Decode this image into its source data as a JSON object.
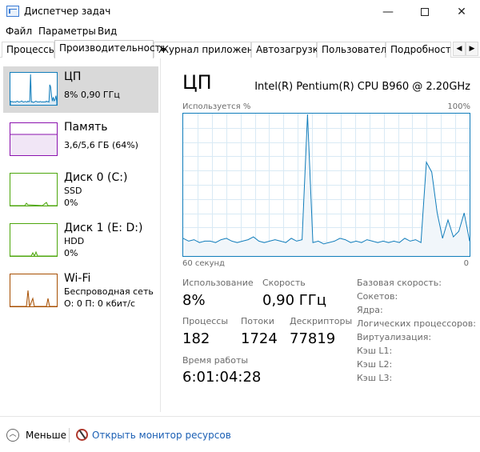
{
  "window": {
    "title": "Диспетчер задач",
    "controls": {
      "minimize": "—",
      "close": "✕"
    }
  },
  "menu": [
    "Файл",
    "Параметры",
    "Вид"
  ],
  "tabs": [
    {
      "label": "Процессы",
      "active": false
    },
    {
      "label": "Производительность",
      "active": true
    },
    {
      "label": "Журнал приложений",
      "active": false
    },
    {
      "label": "Автозагрузка",
      "active": false
    },
    {
      "label": "Пользователи",
      "active": false
    },
    {
      "label": "Подробности",
      "active": false
    }
  ],
  "tab_scroll": {
    "left": "◀",
    "right": "▶"
  },
  "sidebar": [
    {
      "title": "ЦП",
      "lines": [
        "8% 0,90 ГГц"
      ],
      "color": "#117dbb",
      "fill": "#dbeaf4",
      "selected": true
    },
    {
      "title": "Память",
      "lines": [
        "3,6/5,6 ГБ (64%)"
      ],
      "color": "#8b12ae",
      "fill": "#f1e6f6",
      "selected": false
    },
    {
      "title": "Диск 0 (C:)",
      "lines": [
        "SSD",
        "0%"
      ],
      "color": "#4da60c",
      "fill": "#e8f4de",
      "selected": false
    },
    {
      "title": "Диск 1 (E: D:)",
      "lines": [
        "HDD",
        "0%"
      ],
      "color": "#4da60c",
      "fill": "#e8f4de",
      "selected": false
    },
    {
      "title": "Wi-Fi",
      "lines": [
        "Беспроводная сеть",
        "О: 0 П: 0 кбит/с"
      ],
      "color": "#a74f01",
      "fill": "#f6ebe0",
      "selected": false
    }
  ],
  "main": {
    "title": "ЦП",
    "model": "Intel(R) Pentium(R) CPU B960 @ 2.20GHz",
    "graph_label_top_left": "Используется %",
    "graph_label_top_right": "100%",
    "graph_label_bottom_left": "60 секунд",
    "graph_label_bottom_right": "0",
    "stats": {
      "usage_label": "Использование",
      "usage_value": "8%",
      "speed_label": "Скорость",
      "speed_value": "0,90 ГГц",
      "processes_label": "Процессы",
      "processes_value": "182",
      "threads_label": "Потоки",
      "threads_value": "1724",
      "handles_label": "Дескрипторы",
      "handles_value": "77819",
      "uptime_label": "Время работы",
      "uptime_value": "6:01:04:28"
    },
    "specs": [
      "Базовая скорость:",
      "Сокетов:",
      "Ядра:",
      "Логических процессоров:",
      "Виртуализация:",
      "Кэш L1:",
      "Кэш L2:",
      "Кэш L3:"
    ]
  },
  "cpu_usage_history": [
    12,
    10,
    11,
    9,
    10,
    10,
    9,
    11,
    12,
    10,
    9,
    10,
    11,
    13,
    10,
    9,
    10,
    11,
    10,
    9,
    12,
    10,
    11,
    100,
    9,
    10,
    8,
    9,
    10,
    12,
    11,
    9,
    10,
    9,
    11,
    10,
    9,
    10,
    9,
    10,
    9,
    12,
    10,
    11,
    9,
    66,
    59,
    30,
    12,
    25,
    13,
    17,
    30,
    10
  ],
  "footer": {
    "less_label": "Меньше",
    "resource_monitor_link": "Открыть монитор ресурсов"
  }
}
